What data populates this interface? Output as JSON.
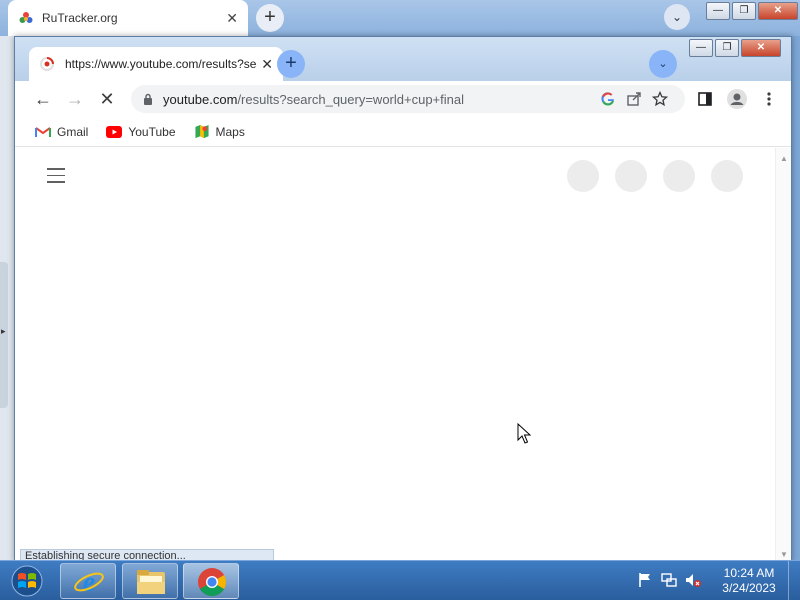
{
  "background_window": {
    "tab_title": "RuTracker.org",
    "tab_close": "✕",
    "new_tab": "+",
    "dropdown": "⌄",
    "controls": {
      "minimize": "—",
      "maximize": "❐",
      "close": "✕"
    }
  },
  "browser": {
    "tab": {
      "title": "https://www.youtube.com/results?search_query=world+cup+final",
      "close": "✕"
    },
    "new_tab": "+",
    "tab_search": "⌄",
    "controls": {
      "minimize": "—",
      "maximize": "❐",
      "close": "✕"
    },
    "toolbar": {
      "back": "←",
      "forward": "→",
      "stop": "✕",
      "url_host": "youtube.com",
      "url_path": "/results?search_query=world+cup+final"
    },
    "bookmarks": [
      {
        "label": "Gmail",
        "icon": "gmail-icon"
      },
      {
        "label": "YouTube",
        "icon": "youtube-icon"
      },
      {
        "label": "Maps",
        "icon": "maps-icon"
      }
    ],
    "status_text": "Establishing secure connection..."
  },
  "taskbar": {
    "clock_time": "10:24 AM",
    "clock_date": "3/24/2023",
    "tray_icons": [
      "flag-icon",
      "network-icon",
      "volume-muted-icon"
    ],
    "pinned": [
      "internet-explorer-icon",
      "file-explorer-icon",
      "chrome-icon"
    ]
  },
  "colors": {
    "accent_blue": "#8ab4f8",
    "taskbar": "#2a5e9e",
    "youtube_red": "#ff0000"
  }
}
